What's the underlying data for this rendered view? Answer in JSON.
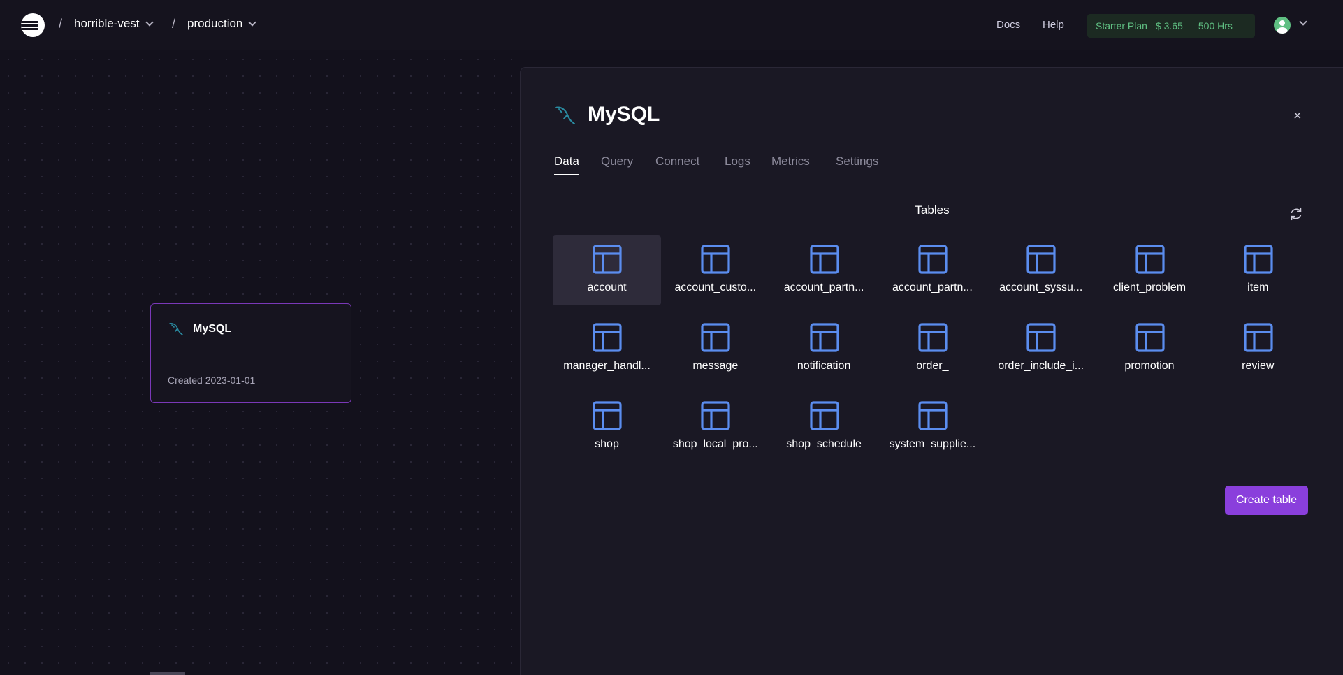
{
  "topbar": {
    "project": "horrible-vest",
    "environment": "production",
    "separator": "/",
    "links": {
      "docs": "Docs",
      "help": "Help"
    },
    "plan": {
      "name": "Starter Plan",
      "cost": "$ 3.65",
      "hours": "500 Hrs"
    }
  },
  "canvas": {
    "card": {
      "title": "MySQL",
      "created": "Created 2023-01-01"
    }
  },
  "panel": {
    "title": "MySQL",
    "close": "×",
    "tabs": [
      {
        "label": "Data",
        "active": true
      },
      {
        "label": "Query",
        "active": false
      },
      {
        "label": "Connect",
        "active": false
      },
      {
        "label": "Logs",
        "active": false
      },
      {
        "label": "Metrics",
        "active": false
      },
      {
        "label": "Settings",
        "active": false
      }
    ],
    "tables_heading": "Tables",
    "tables": [
      "account",
      "account_custo...",
      "account_partn...",
      "account_partn...",
      "account_syssu...",
      "client_problem",
      "item",
      "manager_handl...",
      "message",
      "notification",
      "order_",
      "order_include_i...",
      "promotion",
      "review",
      "shop",
      "shop_local_pro...",
      "shop_schedule",
      "system_supplie..."
    ],
    "selected_table": "account",
    "create_button": "Create table"
  },
  "colors": {
    "accent": "#8a3fdc",
    "table_icon": "#5b8def",
    "plan_green": "#5fbf82"
  }
}
